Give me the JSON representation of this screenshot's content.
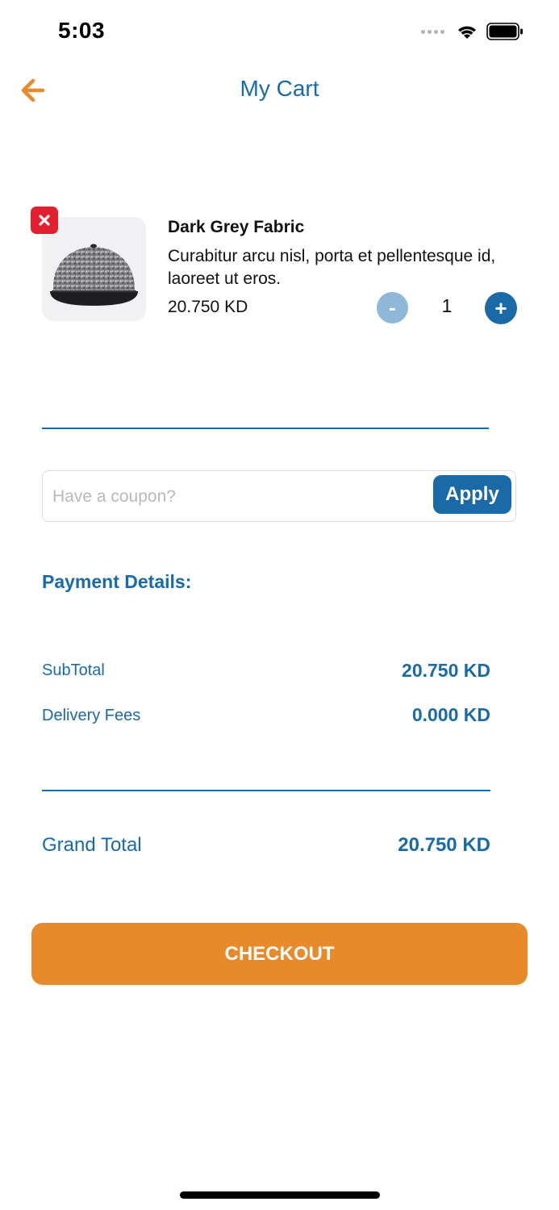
{
  "status_bar": {
    "time": "5:03"
  },
  "header": {
    "title": "My Cart",
    "back_icon": "arrow-left-icon"
  },
  "cart": {
    "items": [
      {
        "name": "Dark Grey Fabric",
        "description": "Curabitur arcu nisl, porta et pellentesque id, laoreet ut eros.",
        "price": "20.750 KD",
        "quantity": "1",
        "minus_label": "-",
        "plus_label": "+",
        "remove_icon": "close-icon",
        "image_icon": "cap-icon"
      }
    ]
  },
  "coupon": {
    "placeholder": "Have a coupon?",
    "value": "",
    "apply_label": "Apply"
  },
  "payment": {
    "title": "Payment Details:",
    "subtotal_label": "SubTotal",
    "subtotal_value": "20.750 KD",
    "delivery_label": "Delivery Fees",
    "delivery_value": "0.000 KD",
    "grand_total_label": "Grand Total",
    "grand_total_value": "20.750 KD"
  },
  "checkout": {
    "label": "CHECKOUT"
  },
  "colors": {
    "primary": "#1a6aa8",
    "accent": "#e98a2a",
    "remove": "#e2202f",
    "minus_disabled": "#8fb7d8"
  }
}
